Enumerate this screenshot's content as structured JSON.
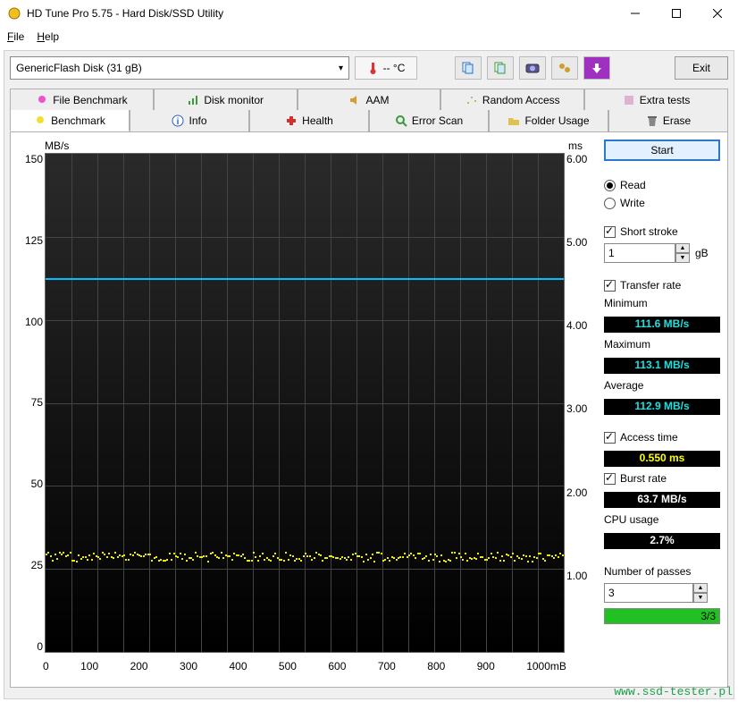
{
  "window": {
    "title": "HD Tune Pro 5.75 - Hard Disk/SSD Utility"
  },
  "menubar": {
    "file": "File",
    "help": "Help"
  },
  "toolbar": {
    "device": "GenericFlash Disk (31 gB)",
    "temperature": "-- °C",
    "exit": "Exit"
  },
  "tabs_row1": [
    "File Benchmark",
    "Disk monitor",
    "AAM",
    "Random Access",
    "Extra tests"
  ],
  "tabs_row2": [
    "Benchmark",
    "Info",
    "Health",
    "Error Scan",
    "Folder Usage",
    "Erase"
  ],
  "chart_data": {
    "type": "line",
    "title": "",
    "xlabel_unit": "mB",
    "ylabel_left": "MB/s",
    "ylabel_right": "ms",
    "x_ticks": [
      "0",
      "100",
      "200",
      "300",
      "400",
      "500",
      "600",
      "700",
      "800",
      "900",
      "1000"
    ],
    "y_left_ticks": [
      "150",
      "125",
      "100",
      "75",
      "50",
      "25",
      "0"
    ],
    "y_right_ticks": [
      "6.00",
      "5.00",
      "4.00",
      "3.00",
      "2.00",
      "1.00",
      ""
    ],
    "ylim_left": [
      0,
      150
    ],
    "ylim_right": [
      0,
      6
    ],
    "series": [
      {
        "name": "Transfer rate",
        "axis": "left",
        "approx_constant_value": 113,
        "style": "line-cyan"
      },
      {
        "name": "Access time",
        "axis": "right",
        "approx_constant_value": 0.55,
        "style": "scatter-yellow"
      }
    ]
  },
  "controls": {
    "start": "Start",
    "read": "Read",
    "write": "Write",
    "short_stroke": "Short stroke",
    "short_stroke_value": "1",
    "short_stroke_unit": "gB",
    "transfer_rate": "Transfer rate",
    "minimum_label": "Minimum",
    "minimum_value": "111.6 MB/s",
    "maximum_label": "Maximum",
    "maximum_value": "113.1 MB/s",
    "average_label": "Average",
    "average_value": "112.9 MB/s",
    "access_time_label": "Access time",
    "access_time_value": "0.550 ms",
    "burst_rate_label": "Burst rate",
    "burst_rate_value": "63.7 MB/s",
    "cpu_usage_label": "CPU usage",
    "cpu_usage_value": "2.7%",
    "passes_label": "Number of passes",
    "passes_value": "3",
    "progress_text": "3/3"
  },
  "watermark": "www.ssd-tester.pl"
}
